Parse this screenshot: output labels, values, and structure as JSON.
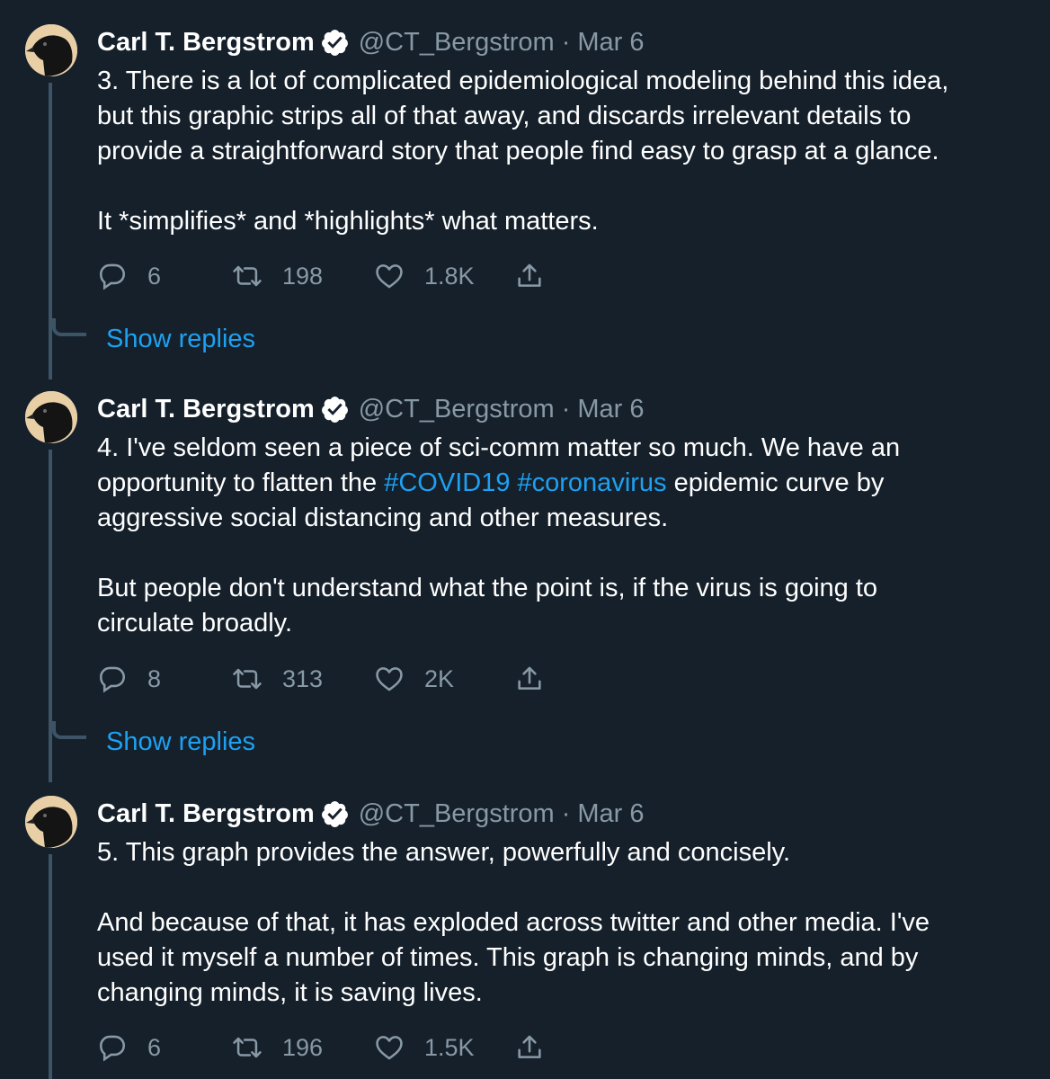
{
  "tweets": [
    {
      "author": "Carl T. Bergstrom",
      "handle": "@CT_Bergstrom",
      "separator": "·",
      "date": "Mar 6",
      "text": {
        "line1": "3. There is a lot of complicated epidemiological modeling behind this idea,",
        "line2": "but this graphic strips all of that away, and discards irrelevant details to",
        "line3": "provide a straightforward story that people find easy to grasp at a glance.",
        "line4": "It *simplifies* and *highlights* what matters."
      },
      "replies": "6",
      "retweets": "198",
      "likes": "1.8K",
      "show_replies": "Show replies"
    },
    {
      "author": "Carl T. Bergstrom",
      "handle": "@CT_Bergstrom",
      "separator": "·",
      "date": "Mar 6",
      "text": {
        "line1": "4. I've seldom seen a piece of sci-comm matter so much. We have an",
        "line2_pre": "opportunity to flatten the ",
        "hashtag1": "#COVID19",
        "hashtag2": "#coronavirus",
        "line2_post": " epidemic curve by",
        "line3": "aggressive social distancing and other measures.",
        "line4": "But people don't understand what the point is, if the virus is going to",
        "line5": "circulate broadly."
      },
      "replies": "8",
      "retweets": "313",
      "likes": "2K",
      "show_replies": "Show replies"
    },
    {
      "author": "Carl T. Bergstrom",
      "handle": "@CT_Bergstrom",
      "separator": "·",
      "date": "Mar 6",
      "text": {
        "line1": "5. This graph provides the answer, powerfully and concisely.",
        "line2": "And because of that, it has exploded across twitter and other media. I've",
        "line3": "used it myself a number of times. This graph is changing minds, and by",
        "line4": "changing minds, it is saving lives."
      },
      "replies": "6",
      "retweets": "196",
      "likes": "1.5K"
    }
  ],
  "icons": {
    "avatar": "crow-avatar",
    "verified": "verified-badge-icon",
    "reply": "speech-bubble-icon",
    "retweet": "retweet-arrows-icon",
    "like": "heart-icon",
    "share": "share-upload-icon"
  },
  "colors": {
    "background": "#15202b",
    "text": "#ffffff",
    "muted": "#8899a6",
    "accent": "#1da1f2",
    "thread_line": "#3d5466"
  }
}
